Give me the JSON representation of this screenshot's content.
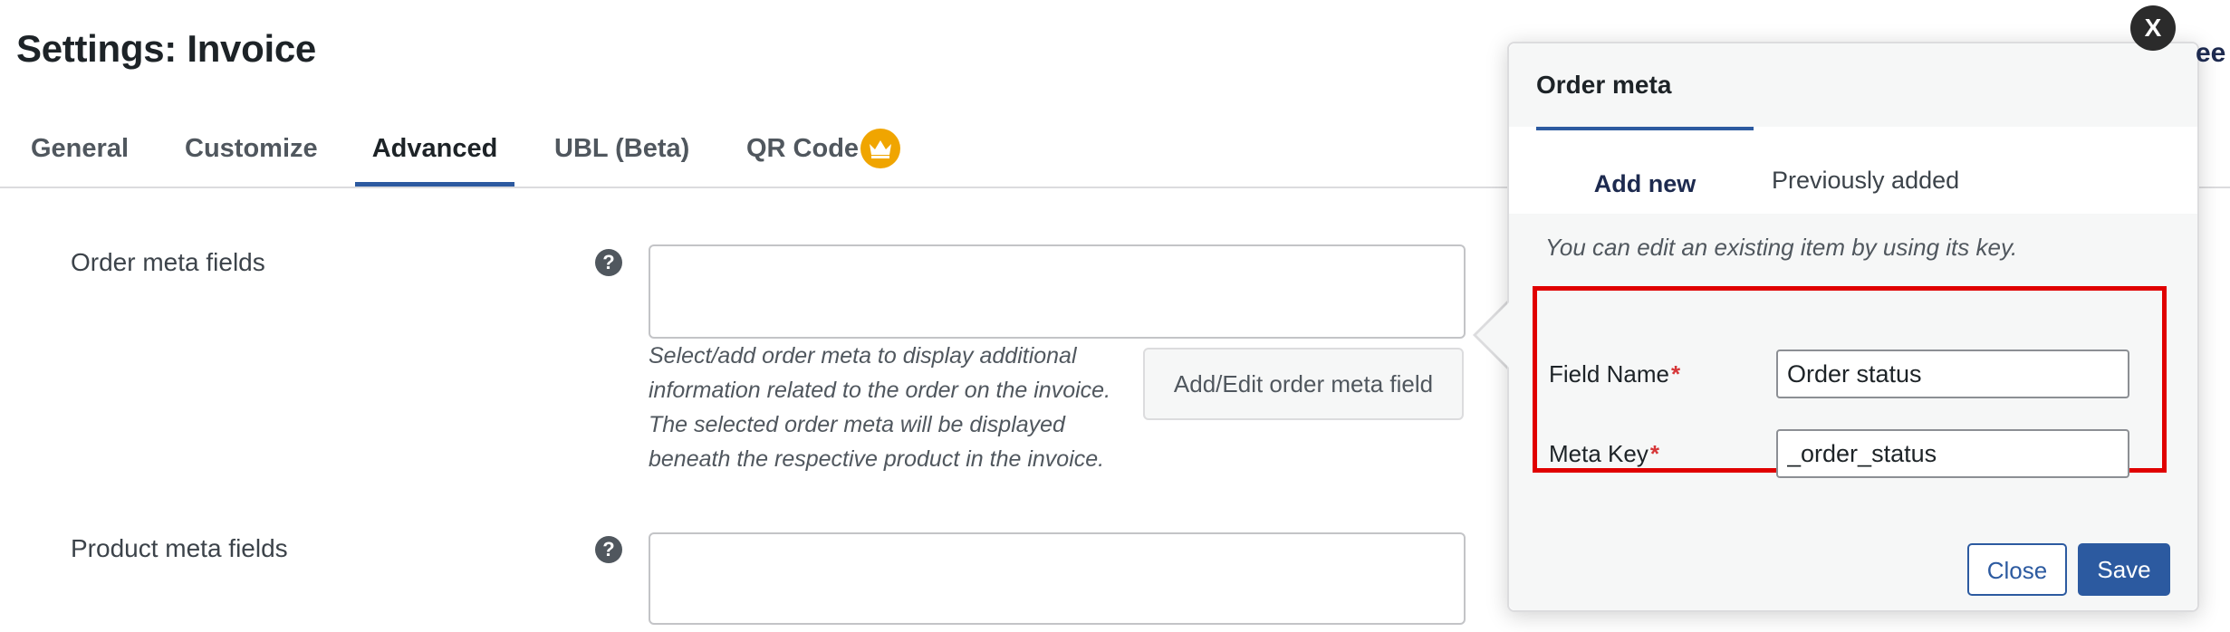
{
  "page": {
    "title": "Settings: Invoice"
  },
  "tabs": [
    {
      "label": "General"
    },
    {
      "label": "Customize"
    },
    {
      "label": "Advanced"
    },
    {
      "label": "UBL (Beta)"
    },
    {
      "label": "QR Code"
    }
  ],
  "active_tab": "Advanced",
  "order_meta_row": {
    "label": "Order meta fields",
    "help": "?",
    "description": [
      "Select/add order meta to display additional",
      "information related to the order on the invoice.",
      "The selected order meta will be displayed",
      "beneath the respective product in the invoice."
    ],
    "button_label": "Add/Edit order meta field"
  },
  "product_meta_row": {
    "label": "Product meta fields",
    "help": "?"
  },
  "popup": {
    "title": "Order meta",
    "tabs": [
      {
        "label": "Add new"
      },
      {
        "label": "Previously added"
      }
    ],
    "hint": "You can edit an existing item by using its key.",
    "fields": [
      {
        "label": "Field Name",
        "required_mark": "*",
        "value": "Order status"
      },
      {
        "label": "Meta Key",
        "required_mark": "*",
        "value": "_order_status"
      }
    ],
    "close_label": "Close",
    "save_label": "Save",
    "dismiss_label": "X"
  },
  "peek_text": "ee",
  "colors": {
    "accent": "#2c5aa0",
    "highlight": "#e00000",
    "premium": "#f0a500",
    "required": "#d63638"
  }
}
